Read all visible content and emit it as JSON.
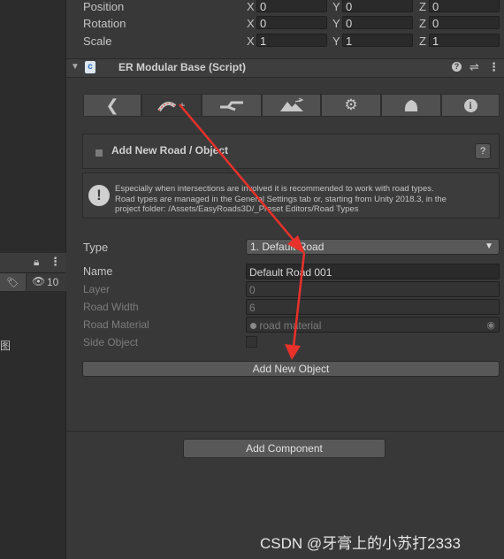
{
  "transform": {
    "rows": [
      {
        "label": "Position",
        "x": "0",
        "y": "0",
        "z": "0"
      },
      {
        "label": "Rotation",
        "x": "0",
        "y": "0",
        "z": "0"
      },
      {
        "label": "Scale",
        "x": "1",
        "y": "1",
        "z": "1"
      }
    ],
    "axes": {
      "x": "X",
      "y": "Y",
      "z": "Z"
    }
  },
  "component": {
    "title": "ER Modular Base (Script)",
    "help_glyph": "?",
    "menu_glyph": "⋮"
  },
  "tabs": [
    {
      "icon": "back-arrow-icon",
      "glyph": "❮"
    },
    {
      "icon": "road-add-icon",
      "glyph": "+"
    },
    {
      "icon": "road-edit-icon",
      "glyph": "⇄"
    },
    {
      "icon": "terrain-icon",
      "glyph": "▲"
    },
    {
      "icon": "gear-icon",
      "glyph": "⚙"
    },
    {
      "icon": "tree-icon",
      "glyph": "●"
    },
    {
      "icon": "info-icon",
      "glyph": "i"
    }
  ],
  "section": {
    "title": "Add New Road / Object",
    "help_button": "?"
  },
  "help_box": {
    "icon": "!",
    "line1": "Especially when intersections are involved it is recommended to work with road types.",
    "line2": "Road types are managed in the General Settings tab or, starting from Unity 2018.3, in the",
    "line3": "project folder: /Assets/EasyRoads3D/_Preset Editors/Road Types"
  },
  "properties": {
    "type_label": "Type",
    "type_value": "1. Default Road",
    "name_label": "Name",
    "name_value": "Default Road 001",
    "layer_label": "Layer",
    "layer_value": "0",
    "width_label": "Road Width",
    "width_value": "6",
    "material_label": "Road Material",
    "material_value": "road material",
    "side_label": "Side Object"
  },
  "buttons": {
    "add_object": "Add New Object",
    "add_component": "Add Component"
  },
  "left_panel": {
    "hidden_count": "10",
    "side_char": "图"
  },
  "watermark": "CSDN @牙膏上的小苏打2333",
  "colors": {
    "annotation_arrow": "#e8312a"
  }
}
